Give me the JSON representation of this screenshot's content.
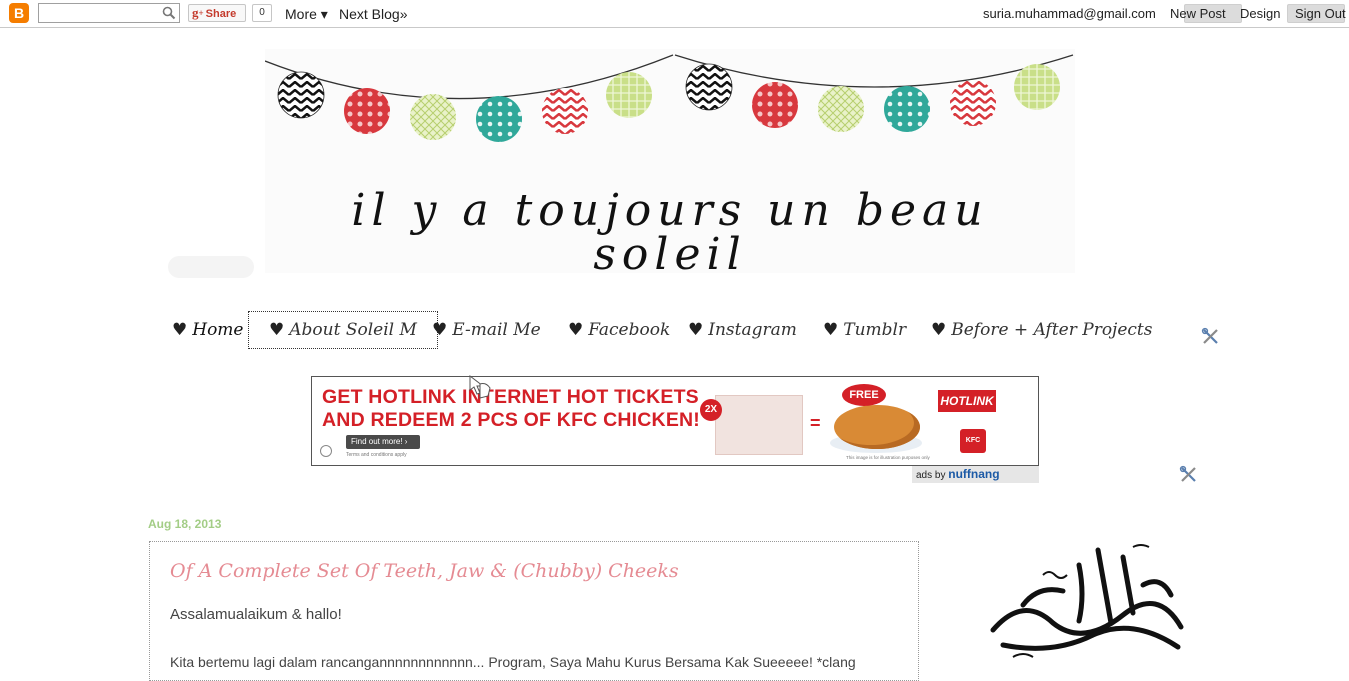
{
  "navbar": {
    "logo": "B",
    "search_placeholder": "",
    "share_g": "g",
    "share_plus": "+",
    "share_label": "Share",
    "share_count": "0",
    "more": "More ▾",
    "next_blog": "Next Blog»",
    "email": "suria.muhammad@gmail.com",
    "new_post": "New Post",
    "design": "Design",
    "sign_out": "Sign Out"
  },
  "header": {
    "title": "il y a toujours un beau soleil"
  },
  "tabs": [
    {
      "heart": "♥",
      "label": "Home"
    },
    {
      "heart": "♥",
      "label": "About Soleil M"
    },
    {
      "heart": "♥",
      "label": "E-mail Me"
    },
    {
      "heart": "♥",
      "label": "Facebook"
    },
    {
      "heart": "♥",
      "label": "Instagram"
    },
    {
      "heart": "♥",
      "label": "Tumblr"
    },
    {
      "heart": "♥",
      "label": "Before + After Projects"
    }
  ],
  "ad": {
    "headline_1": "GET HOTLINK INTERNET HOT TICKETS",
    "headline_2": "AND REDEEM 2 PCS OF KFC CHICKEN!",
    "find_out": "Find out more! ›",
    "terms": "Terms and conditions apply",
    "multiplier": "2X",
    "equals": "=",
    "free": "FREE",
    "brand": "HOTLINK",
    "kfc": "KFC",
    "note": "This image is for illustration purposes only",
    "ads_by": "ads by",
    "network": "nuffnang"
  },
  "post": {
    "date": "Aug 18, 2013",
    "title": "Of A Complete Set Of Teeth, Jaw & (Chubby) Cheeks",
    "greeting": "Assalamualaikum & hallo!",
    "body": "Kita bertemu lagi dalam rancangannnnnnnnnnnn... Program, Saya Mahu Kurus Bersama Kak Sueeeee! *clang"
  },
  "icons": {
    "tabs_edit": "wrench-screwdriver-icon",
    "ad_edit": "wrench-screwdriver-icon"
  },
  "colors": {
    "brand_orange": "#f57d00",
    "date_green": "#a3cd86",
    "title_pink": "#e58b93",
    "ad_red": "#d42027"
  }
}
